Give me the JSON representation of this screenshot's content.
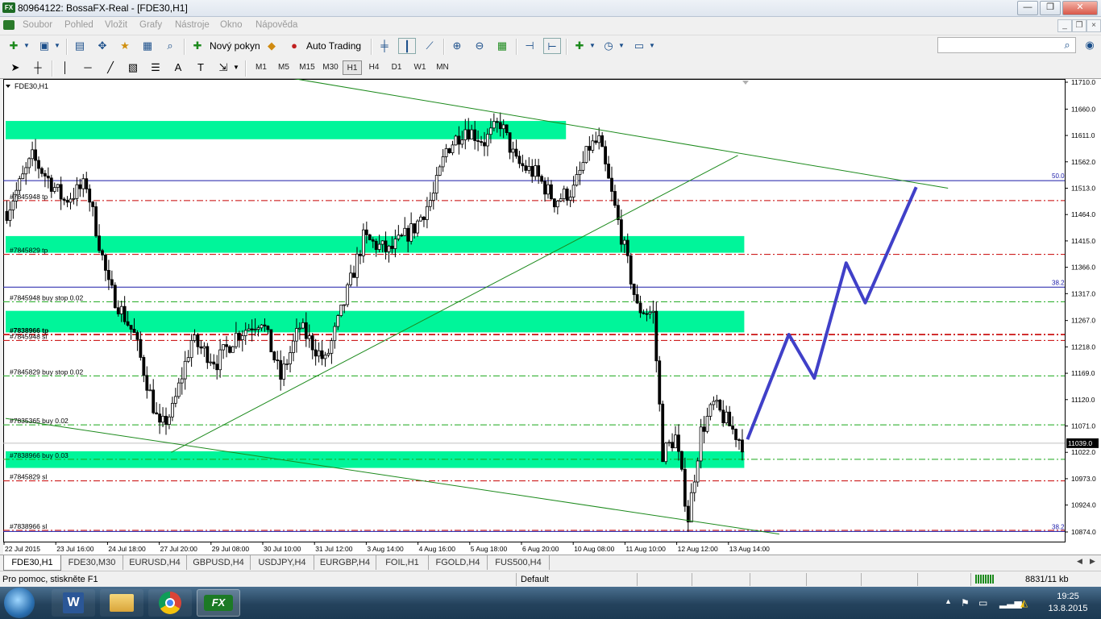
{
  "window": {
    "title": "80964122: BossaFX-Real - [FDE30,H1]",
    "app_icon_text": "FX",
    "minimize": "—",
    "maximize": "❐",
    "close": "✕"
  },
  "menu": {
    "items": [
      "Soubor",
      "Pohled",
      "Vložit",
      "Grafy",
      "Nástroje",
      "Okno",
      "Nápověda"
    ]
  },
  "toolbar": {
    "new_order_label": "Nový pokyn",
    "auto_trading_label": "Auto Trading",
    "search_placeholder": ""
  },
  "timeframes": [
    "M1",
    "M5",
    "M15",
    "M30",
    "H1",
    "H4",
    "D1",
    "W1",
    "MN"
  ],
  "active_timeframe": "H1",
  "chart": {
    "label": "FDE30,H1",
    "current_price": "11039.0",
    "colors": {
      "zone": "#00f59a",
      "candle": "#000000",
      "channel": "#1c8a1c",
      "fib_line": "#1a1aa8",
      "order_line": "#c80000",
      "tp_line": "#1aa81a",
      "projection": "#4040c8"
    }
  },
  "chart_data": {
    "type": "candlestick",
    "symbol": "FDE30",
    "timeframe": "H1",
    "y_ticks": [
      11710.0,
      11660.0,
      11611.0,
      11562.0,
      11513.0,
      11464.0,
      11415.0,
      11366.0,
      11317.0,
      11267.0,
      11218.0,
      11169.0,
      11120.0,
      11071.0,
      11022.0,
      10973.0,
      10924.0,
      10874.0
    ],
    "y_tick_labels": [
      "11710.0",
      "11660.0",
      "11611.0",
      "11562.0",
      "11513.0",
      "11464.0",
      "11415.0",
      "11366.0",
      "11317.0",
      "11267.0",
      "11218.0",
      "11169.0",
      "11120.0",
      "11071.0",
      "11022.0",
      "10973.0",
      "10924.0",
      "10874.0"
    ],
    "ylim": [
      10864,
      11722
    ],
    "x_labels": [
      "22 Jul 2015",
      "23 Jul 16:00",
      "24 Jul 18:00",
      "27 Jul 20:00",
      "29 Jul 08:00",
      "30 Jul 10:00",
      "31 Jul 12:00",
      "3 Aug 14:00",
      "4 Aug 16:00",
      "5 Aug 18:00",
      "6 Aug 20:00",
      "10 Aug 08:00",
      "11 Aug 10:00",
      "12 Aug 12:00",
      "13 Aug 14:00"
    ],
    "bars_visible": 232,
    "key_closes": [
      {
        "bar": 0,
        "close": 11470
      },
      {
        "bar": 8,
        "close": 11570
      },
      {
        "bar": 18,
        "close": 11490
      },
      {
        "bar": 25,
        "close": 11520
      },
      {
        "bar": 32,
        "close": 11330
      },
      {
        "bar": 40,
        "close": 11240
      },
      {
        "bar": 48,
        "close": 11065
      },
      {
        "bar": 52,
        "close": 11100
      },
      {
        "bar": 58,
        "close": 11230
      },
      {
        "bar": 66,
        "close": 11190
      },
      {
        "bar": 72,
        "close": 11240
      },
      {
        "bar": 80,
        "close": 11270
      },
      {
        "bar": 86,
        "close": 11160
      },
      {
        "bar": 92,
        "close": 11255
      },
      {
        "bar": 100,
        "close": 11190
      },
      {
        "bar": 106,
        "close": 11300
      },
      {
        "bar": 112,
        "close": 11420
      },
      {
        "bar": 120,
        "close": 11395
      },
      {
        "bar": 128,
        "close": 11440
      },
      {
        "bar": 134,
        "close": 11500
      },
      {
        "bar": 138,
        "close": 11585
      },
      {
        "bar": 144,
        "close": 11625
      },
      {
        "bar": 150,
        "close": 11600
      },
      {
        "bar": 155,
        "close": 11635
      },
      {
        "bar": 160,
        "close": 11560
      },
      {
        "bar": 166,
        "close": 11540
      },
      {
        "bar": 172,
        "close": 11490
      },
      {
        "bar": 178,
        "close": 11510
      },
      {
        "bar": 183,
        "close": 11590
      },
      {
        "bar": 186,
        "close": 11600
      },
      {
        "bar": 190,
        "close": 11500
      },
      {
        "bar": 194,
        "close": 11400
      },
      {
        "bar": 198,
        "close": 11290
      },
      {
        "bar": 203,
        "close": 11280
      },
      {
        "bar": 206,
        "close": 11020
      },
      {
        "bar": 210,
        "close": 11050
      },
      {
        "bar": 214,
        "close": 10900
      },
      {
        "bar": 218,
        "close": 11060
      },
      {
        "bar": 222,
        "close": 11110
      },
      {
        "bar": 226,
        "close": 11080
      },
      {
        "bar": 231,
        "close": 11039
      }
    ],
    "zones": [
      {
        "low": 11604,
        "high": 11638,
        "bar_start": 0,
        "bar_end": 176
      },
      {
        "low": 11393,
        "high": 11424,
        "bar_start": 0,
        "bar_end": 232
      },
      {
        "low": 11245,
        "high": 11285,
        "bar_start": 0,
        "bar_end": 232
      },
      {
        "low": 10993,
        "high": 11024,
        "bar_start": 0,
        "bar_end": 232
      }
    ],
    "fib_levels": [
      {
        "label": "50.0",
        "price": 11527
      },
      {
        "label": "38.2",
        "price": 11329
      },
      {
        "label": "38.2",
        "price": 10875
      }
    ],
    "orders": [
      {
        "label": "#7845948 tp",
        "price": 11490,
        "kind": "tp"
      },
      {
        "label": "#7845829 tp",
        "price": 11390,
        "kind": "tp"
      },
      {
        "label": "#7845948 buy stop 0.02",
        "price": 11302,
        "kind": "buy"
      },
      {
        "label": "#7838966 tp",
        "price": 11241,
        "kind": "tp"
      },
      {
        "label": "#7845948 sl",
        "price": 11230,
        "kind": "sl"
      },
      {
        "label": "#7845829 buy stop 0.02",
        "price": 11164,
        "kind": "buy"
      },
      {
        "label": "#7835365 buy 0.02",
        "price": 11073,
        "kind": "buy"
      },
      {
        "label": "#7838966 buy 0.03",
        "price": 11009,
        "kind": "buy"
      },
      {
        "label": "#7845829 sl",
        "price": 10969,
        "kind": "sl"
      },
      {
        "label": "#7838966 sl",
        "price": 10877,
        "kind": "sl"
      }
    ],
    "channel_lines": [
      {
        "bar1": 52,
        "price1": 11022,
        "bar2": 230,
        "price2": 11574
      },
      {
        "bar1": 72,
        "price1": 11735,
        "bar2": 296,
        "price2": 11513
      },
      {
        "bar1": 0,
        "price1": 11085,
        "bar2": 243,
        "price2": 10870
      }
    ],
    "projection_path": [
      {
        "bar": 233,
        "price": 11046
      },
      {
        "bar": 246,
        "price": 11241
      },
      {
        "bar": 254,
        "price": 11160
      },
      {
        "bar": 264,
        "price": 11374
      },
      {
        "bar": 270,
        "price": 11300
      },
      {
        "bar": 286,
        "price": 11515
      }
    ]
  },
  "tabs": [
    "FDE30,H1",
    "FDE30,M30",
    "EURUSD,H4",
    "GBPUSD,H4",
    "USDJPY,H4",
    "EURGBP,H4",
    "FOIL,H1",
    "FGOLD,H4",
    "FUS500,H4"
  ],
  "active_tab": "FDE30,H1",
  "status": {
    "help": "Pro pomoc, stiskněte F1",
    "profile": "Default",
    "traffic": "8831/11 kb"
  },
  "taskbar": {
    "time": "19:25",
    "date": "13.8.2015",
    "word_label": "W",
    "fx_label": "FX"
  }
}
